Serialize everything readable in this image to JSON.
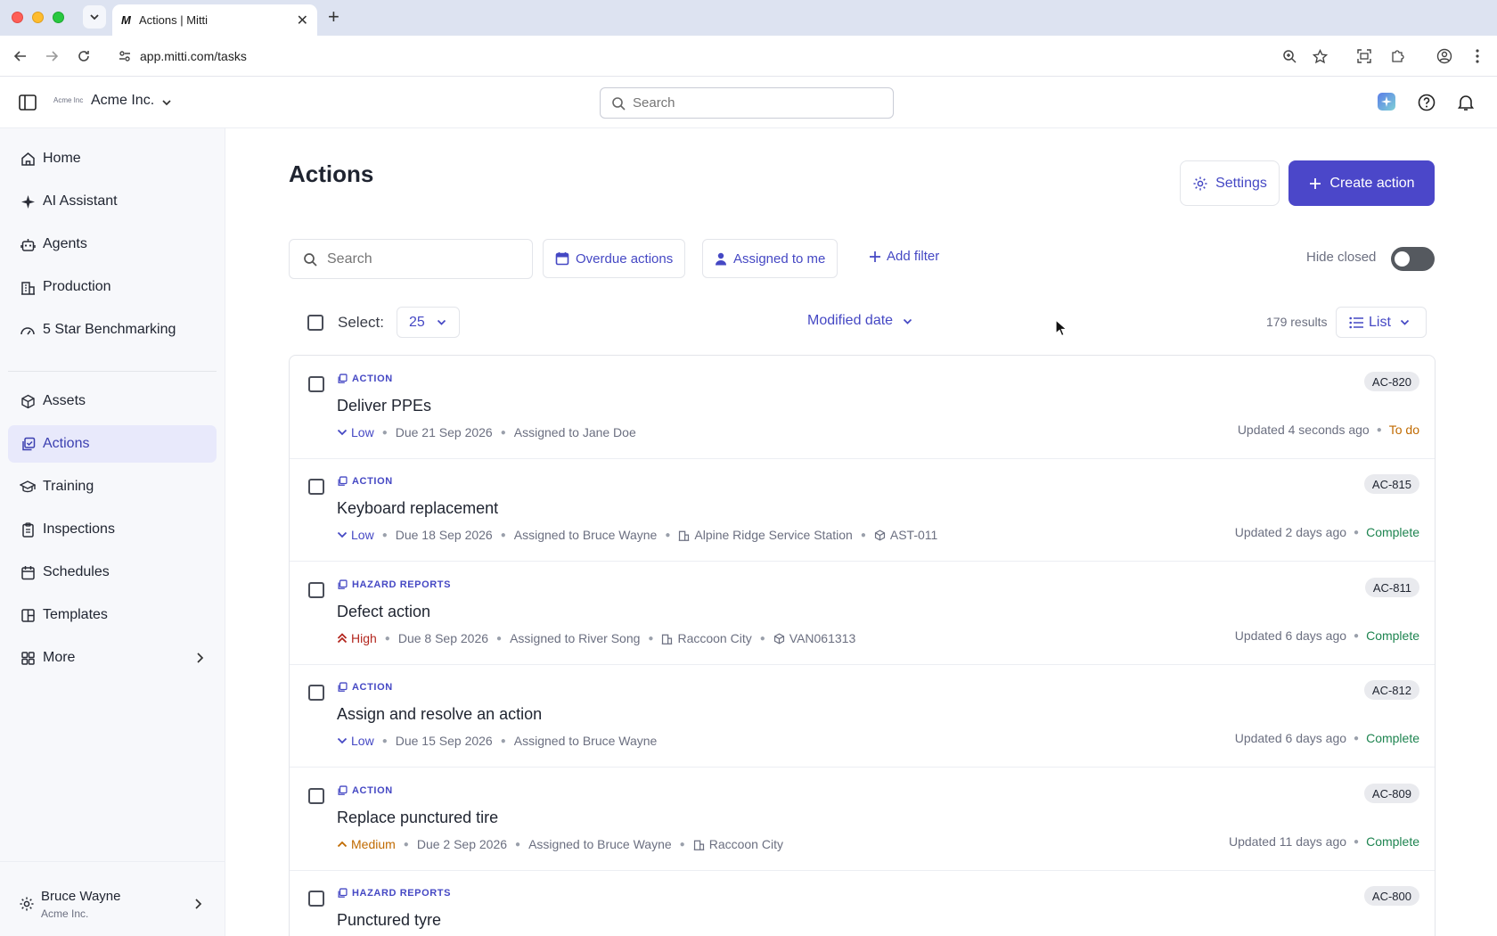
{
  "browser": {
    "tab_favicon": "M",
    "tab_title": "Actions | Mitti",
    "url": "app.mitti.com/tasks"
  },
  "header": {
    "logo_text": "Acme Inc",
    "org_name": "Acme Inc.",
    "search_placeholder": "Search"
  },
  "sidebar": {
    "items": [
      {
        "label": "Home",
        "icon": "home-icon"
      },
      {
        "label": "AI Assistant",
        "icon": "sparkle-icon"
      },
      {
        "label": "Agents",
        "icon": "robot-icon"
      },
      {
        "label": "Production",
        "icon": "building-icon"
      },
      {
        "label": "5 Star Benchmarking",
        "icon": "gauge-icon"
      },
      {
        "label": "Assets",
        "icon": "cube-icon"
      },
      {
        "label": "Actions",
        "icon": "actions-icon",
        "active": true
      },
      {
        "label": "Training",
        "icon": "graduation-cap-icon"
      },
      {
        "label": "Inspections",
        "icon": "clipboard-icon"
      },
      {
        "label": "Schedules",
        "icon": "calendar-icon"
      },
      {
        "label": "Templates",
        "icon": "template-icon"
      },
      {
        "label": "More",
        "icon": "grid-icon"
      }
    ],
    "user": {
      "name": "Bruce Wayne",
      "org": "Acme Inc."
    }
  },
  "main": {
    "title": "Actions",
    "settings_label": "Settings",
    "create_label": "Create action",
    "search_placeholder": "Search",
    "filters": {
      "overdue": "Overdue actions",
      "assigned": "Assigned to me",
      "add": "Add filter",
      "hide_closed": "Hide closed",
      "hide_closed_on": false
    },
    "toolbar": {
      "select_label": "Select:",
      "page_size": "25",
      "sort": "Modified date",
      "results": "179 results",
      "view": "List"
    },
    "rows": [
      {
        "type": "ACTION",
        "title": "Deliver PPEs",
        "priority": "Low",
        "due": "Due 21 Sep 2026",
        "assigned": "Assigned to Jane Doe",
        "site": "",
        "asset": "",
        "id": "AC-820",
        "updated": "Updated 4 seconds ago",
        "status": "To do"
      },
      {
        "type": "ACTION",
        "title": "Keyboard replacement",
        "priority": "Low",
        "due": "Due 18 Sep 2026",
        "assigned": "Assigned to Bruce Wayne",
        "site": "Alpine Ridge Service Station",
        "asset": "AST-011",
        "id": "AC-815",
        "updated": "Updated 2 days ago",
        "status": "Complete"
      },
      {
        "type": "HAZARD REPORTS",
        "title": "Defect action",
        "priority": "High",
        "due": "Due 8 Sep 2026",
        "assigned": "Assigned to River Song",
        "site": "Raccoon City",
        "asset": "VAN061313",
        "id": "AC-811",
        "updated": "Updated 6 days ago",
        "status": "Complete"
      },
      {
        "type": "ACTION",
        "title": "Assign and resolve an action",
        "priority": "Low",
        "due": "Due 15 Sep 2026",
        "assigned": "Assigned to Bruce Wayne",
        "site": "",
        "asset": "",
        "id": "AC-812",
        "updated": "Updated 6 days ago",
        "status": "Complete"
      },
      {
        "type": "ACTION",
        "title": "Replace punctured tire",
        "priority": "Medium",
        "due": "Due 2 Sep 2026",
        "assigned": "Assigned to Bruce Wayne",
        "site": "Raccoon City",
        "asset": "",
        "id": "AC-809",
        "updated": "Updated 11 days ago",
        "status": "Complete"
      },
      {
        "type": "HAZARD REPORTS",
        "title": "Punctured tyre",
        "priority": "",
        "due": "",
        "assigned": "",
        "site": "",
        "asset": "",
        "id": "AC-800",
        "updated": "",
        "status": ""
      }
    ]
  },
  "colors": {
    "accent": "#4b47c9",
    "link": "#4548c4",
    "todo": "#c06a00",
    "complete": "#1e8450",
    "high": "#b3261e"
  }
}
